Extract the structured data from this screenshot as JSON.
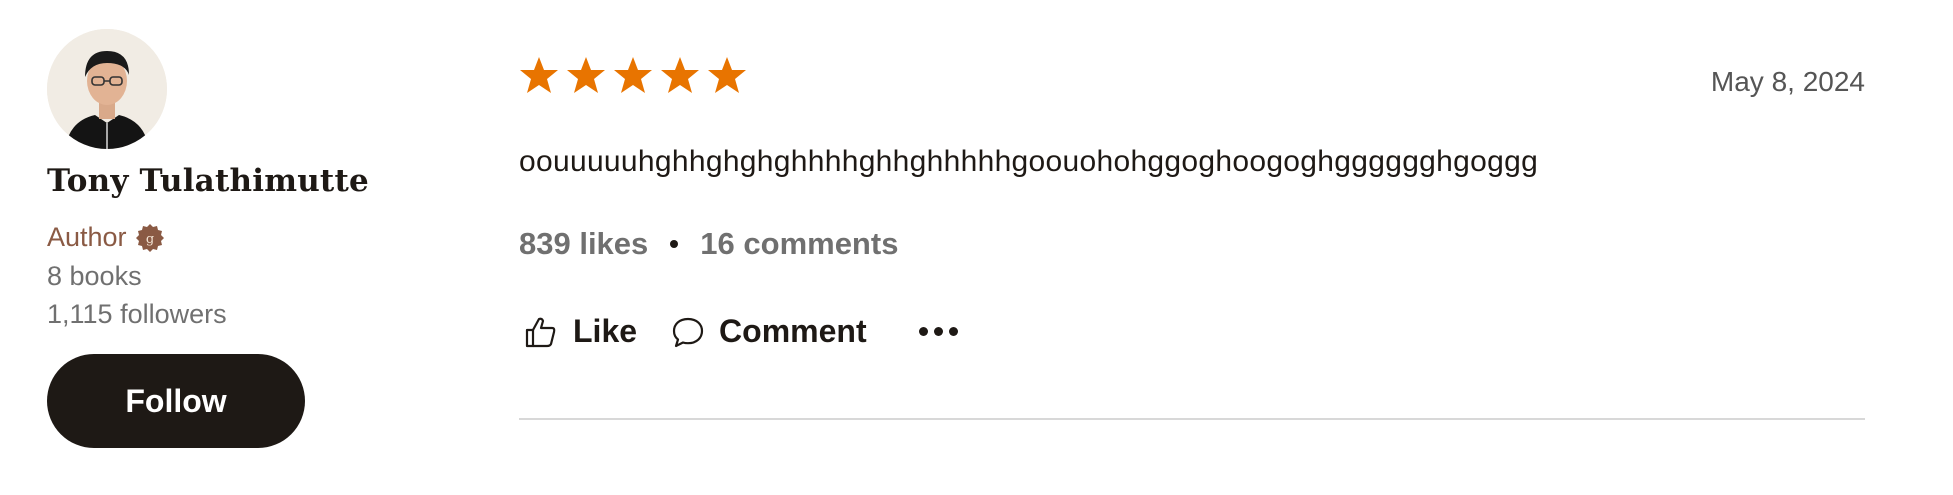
{
  "author": {
    "name": "Tony Tulathimutte",
    "role": "Author",
    "books": "8 books",
    "followers": "1,115 followers",
    "follow_label": "Follow",
    "badge_color": "#8a5a44"
  },
  "review": {
    "rating": 5,
    "rating_max": 5,
    "star_color": "#e87400",
    "date": "May 8, 2024",
    "text": "oouuuuuhghhghghghhhhghhghhhhhgoouohohggoghoogoghgggggghgoggg",
    "likes": "839 likes",
    "comments": "16 comments"
  },
  "actions": {
    "like_label": "Like",
    "comment_label": "Comment",
    "more_icon": "more-icon"
  }
}
